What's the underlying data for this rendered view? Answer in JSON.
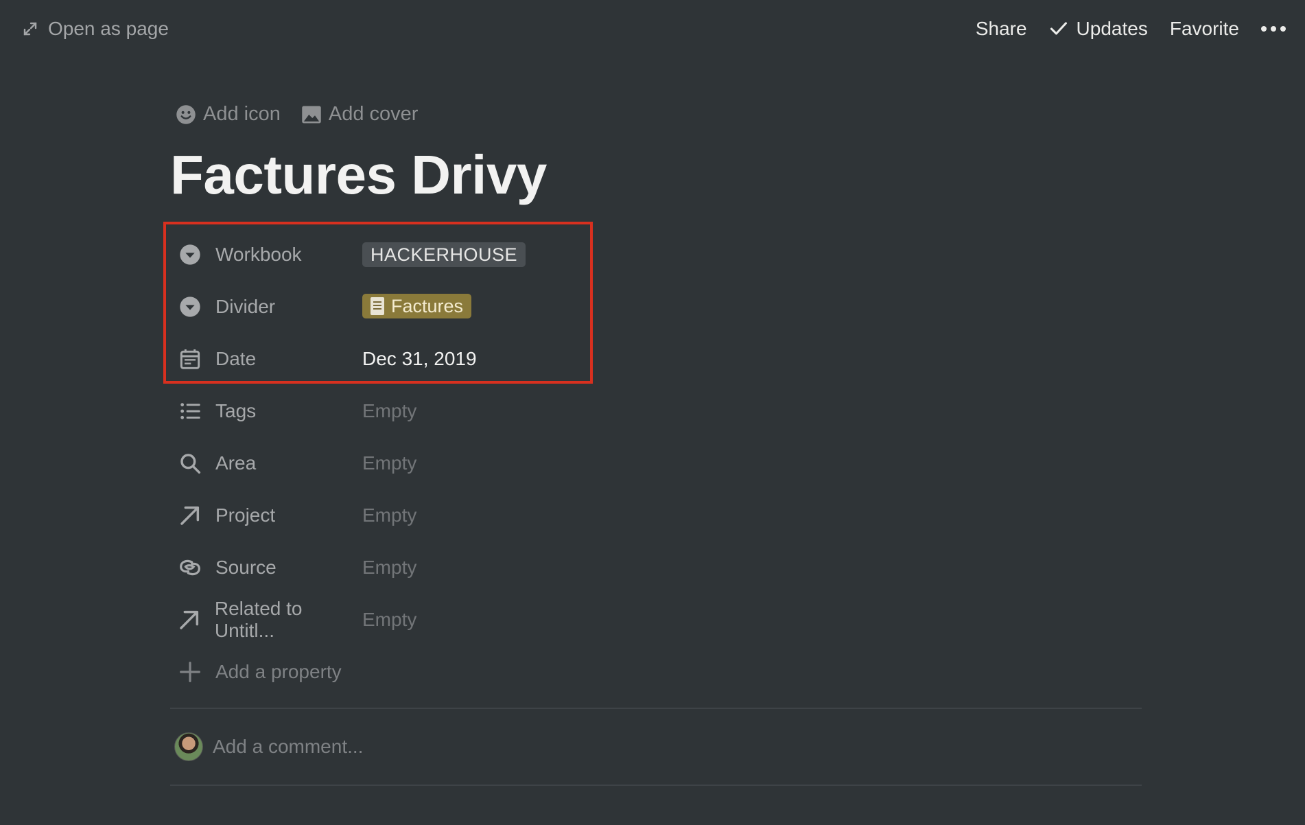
{
  "topbar": {
    "open_as_page": "Open as page",
    "share": "Share",
    "updates": "Updates",
    "favorite": "Favorite"
  },
  "page": {
    "add_icon": "Add icon",
    "add_cover": "Add cover",
    "title": "Factures Drivy"
  },
  "properties": [
    {
      "name": "Workbook",
      "icon": "select-icon",
      "value": "HACKERHOUSE"
    },
    {
      "name": "Divider",
      "icon": "select-icon",
      "value": "Factures"
    },
    {
      "name": "Date",
      "icon": "calendar-icon",
      "value": "Dec 31, 2019"
    },
    {
      "name": "Tags",
      "icon": "list-icon",
      "value": "Empty"
    },
    {
      "name": "Area",
      "icon": "search-icon",
      "value": "Empty"
    },
    {
      "name": "Project",
      "icon": "relation-arrow-icon",
      "value": "Empty"
    },
    {
      "name": "Source",
      "icon": "rollup-icon",
      "value": "Empty"
    },
    {
      "name": "Related to Untitl...",
      "icon": "relation-arrow-icon",
      "value": "Empty"
    }
  ],
  "add_property": "Add a property",
  "comment": {
    "placeholder": "Add a comment..."
  },
  "colors": {
    "background": "#2f3437",
    "highlight_border": "#d8301f",
    "tag_grey": "#4a4f53",
    "tag_gold": "#8a7a3a"
  }
}
